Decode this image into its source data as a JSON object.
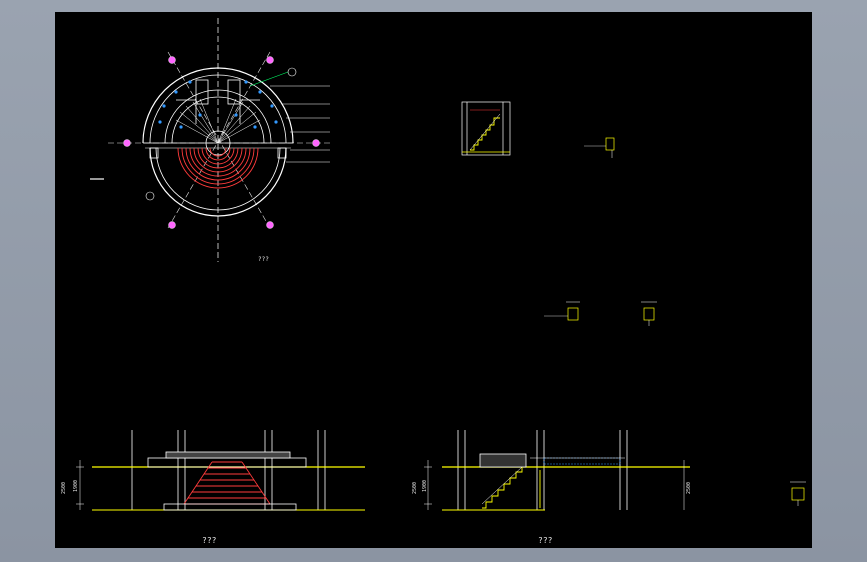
{
  "drawing": {
    "plan_label": "???",
    "section_a_label": "???",
    "section_b_label": "???",
    "dim_a_total": "2500",
    "dim_a_mid": "1900",
    "dim_b_total": "2500",
    "dim_b_mid": "1900",
    "dim_b_right": "2500"
  },
  "colors": {
    "background": "#000000",
    "outer_frame": "#9aa3b0",
    "line_white": "#ffffff",
    "line_yellow": "#ffff00",
    "line_red": "#ff3b3b",
    "marker_magenta": "#ff66ff",
    "marker_blue": "#3399ff",
    "line_green": "#00ff66"
  }
}
